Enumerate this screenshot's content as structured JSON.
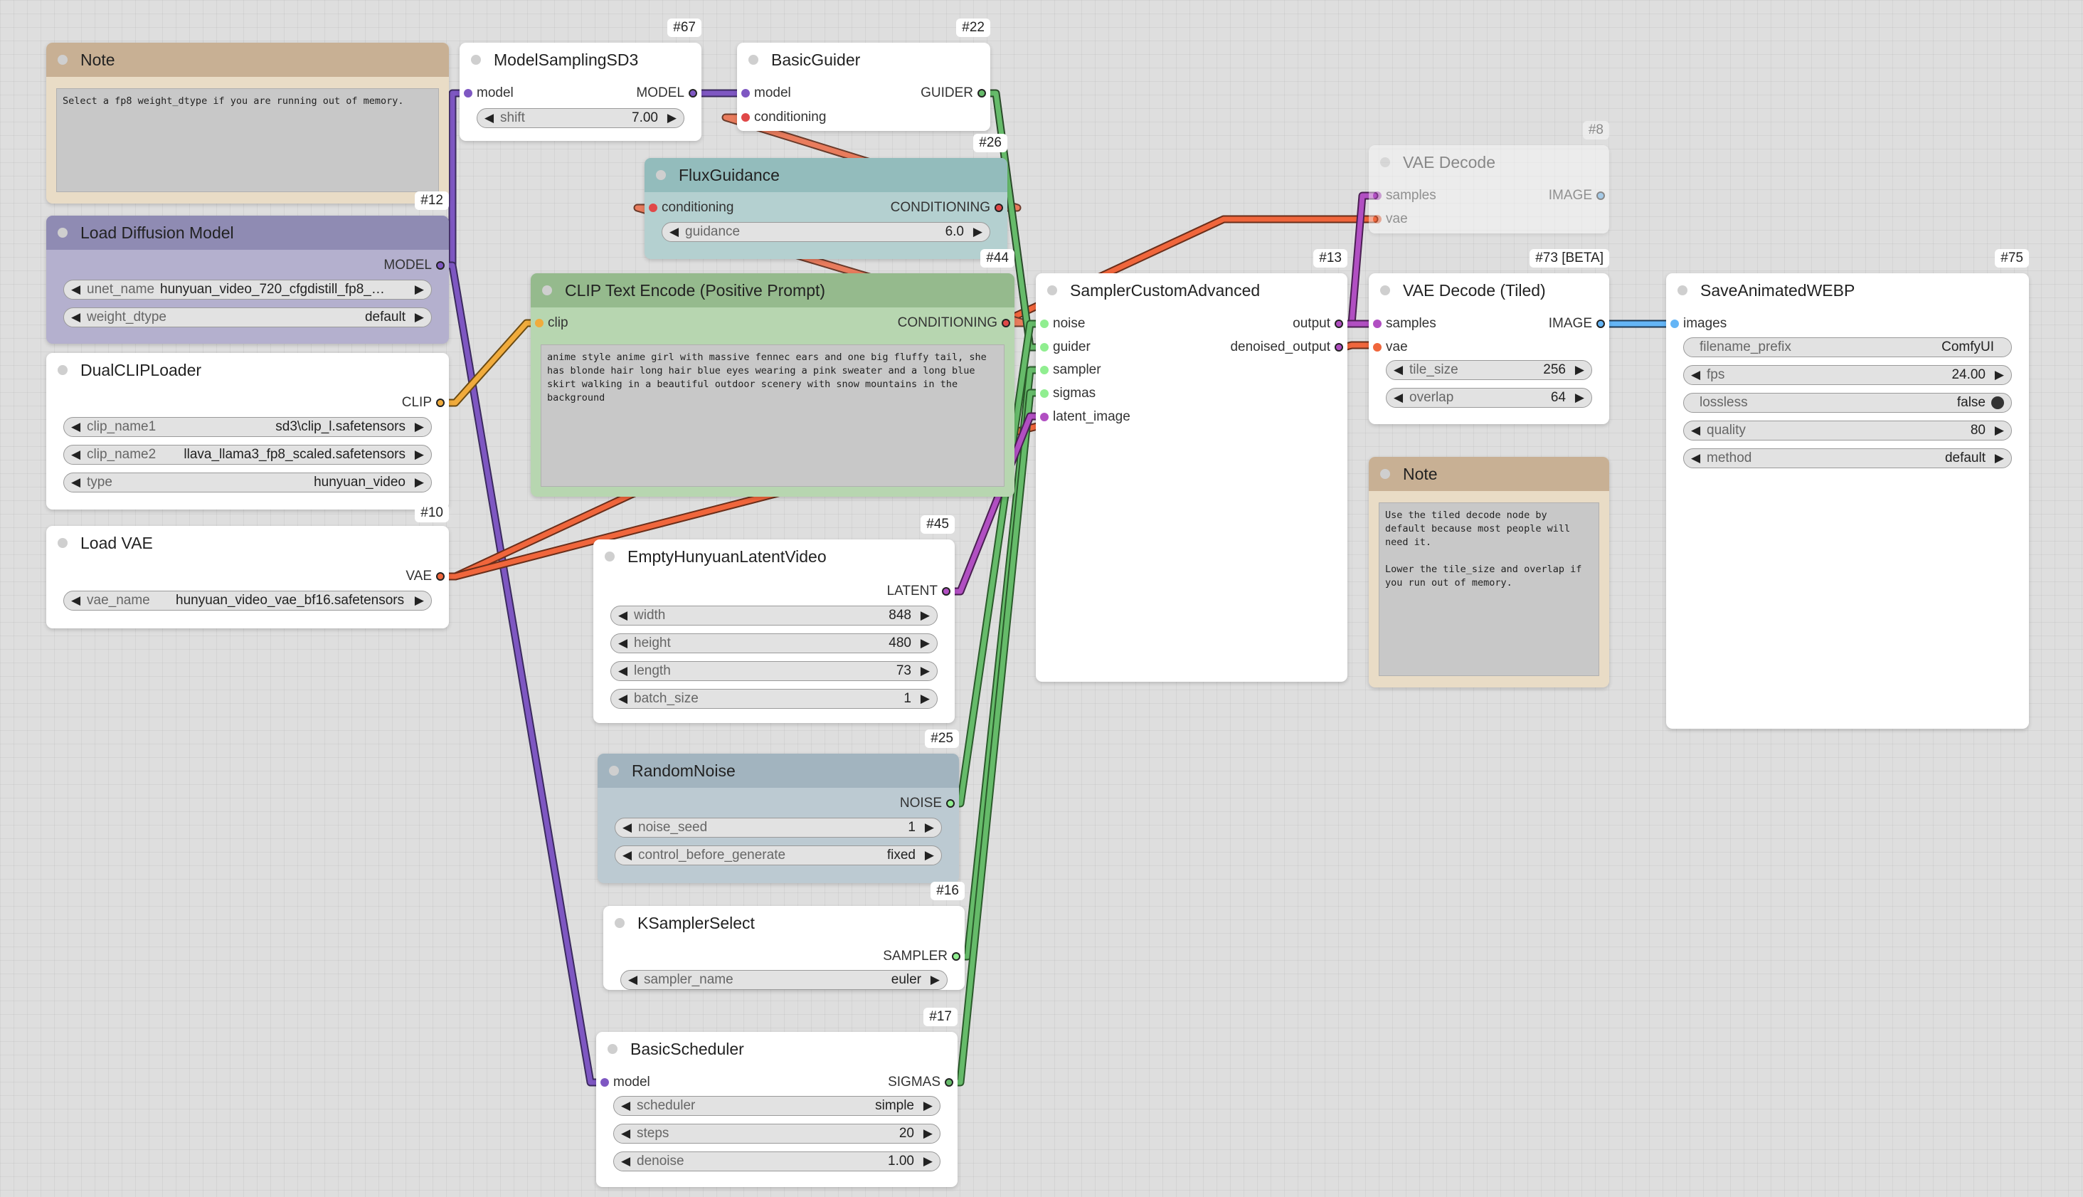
{
  "colors": {
    "model": "#7e57c2",
    "clip": "#f0ab3c",
    "vae": "#f0663c",
    "conditioning": "#e97c5d",
    "guider": "#66bb6a",
    "latent": "#b14fc2",
    "image": "#64b5f6",
    "noise": "#90ee90",
    "sigmas": "#66bb6a"
  },
  "nodes": {
    "note1": {
      "title": "Note",
      "text": "Select a fp8 weight_dtype if you are running out of memory."
    },
    "load_diffusion": {
      "id": "#12",
      "title": "Load Diffusion Model",
      "output": "MODEL",
      "widgets": [
        {
          "name": "unet_name",
          "value": "hunyuan_video_720_cfgdistill_fp8_…"
        },
        {
          "name": "weight_dtype",
          "value": "default"
        }
      ]
    },
    "dualclip": {
      "id": "#10",
      "title": "DualCLIPLoader",
      "output": "CLIP",
      "widgets": [
        {
          "name": "clip_name1",
          "value": "sd3\\clip_l.safetensors"
        },
        {
          "name": "clip_name2",
          "value": "llava_llama3_fp8_scaled.safetensors"
        },
        {
          "name": "type",
          "value": "hunyuan_video"
        }
      ]
    },
    "load_vae": {
      "title": "Load VAE",
      "output": "VAE",
      "widgets": [
        {
          "name": "vae_name",
          "value": "hunyuan_video_vae_bf16.safetensors"
        }
      ]
    },
    "modelsampling": {
      "id": "#67",
      "title": "ModelSamplingSD3",
      "input": "model",
      "output": "MODEL",
      "widgets": [
        {
          "name": "shift",
          "value": "7.00"
        }
      ]
    },
    "basicguider": {
      "id": "#22",
      "title": "BasicGuider",
      "inputs": [
        "model",
        "conditioning"
      ],
      "output": "GUIDER"
    },
    "fluxguidance": {
      "id": "#26",
      "title": "FluxGuidance",
      "input": "conditioning",
      "output": "CONDITIONING",
      "widgets": [
        {
          "name": "guidance",
          "value": "6.0"
        }
      ]
    },
    "clipencode": {
      "id": "#44",
      "title": "CLIP Text Encode (Positive Prompt)",
      "input": "clip",
      "output": "CONDITIONING",
      "text": "anime style anime girl with massive fennec ears and one big fluffy tail, she has blonde hair long hair blue eyes wearing a pink sweater and a long blue skirt walking in a beautiful outdoor scenery with snow mountains in the background"
    },
    "emptylatent": {
      "id": "#45",
      "title": "EmptyHunyuanLatentVideo",
      "output": "LATENT",
      "widgets": [
        {
          "name": "width",
          "value": "848"
        },
        {
          "name": "height",
          "value": "480"
        },
        {
          "name": "length",
          "value": "73"
        },
        {
          "name": "batch_size",
          "value": "1"
        }
      ]
    },
    "randomnoise": {
      "id": "#25",
      "title": "RandomNoise",
      "output": "NOISE",
      "widgets": [
        {
          "name": "noise_seed",
          "value": "1"
        },
        {
          "name": "control_before_generate",
          "value": "fixed"
        }
      ]
    },
    "ksamplerselect": {
      "id": "#16",
      "title": "KSamplerSelect",
      "output": "SAMPLER",
      "widgets": [
        {
          "name": "sampler_name",
          "value": "euler"
        }
      ]
    },
    "basicscheduler": {
      "id": "#17",
      "title": "BasicScheduler",
      "input": "model",
      "output": "SIGMAS",
      "widgets": [
        {
          "name": "scheduler",
          "value": "simple"
        },
        {
          "name": "steps",
          "value": "20"
        },
        {
          "name": "denoise",
          "value": "1.00"
        }
      ]
    },
    "sampler": {
      "id": "#13",
      "title": "SamplerCustomAdvanced",
      "inputs": [
        "noise",
        "guider",
        "sampler",
        "sigmas",
        "latent_image"
      ],
      "outputs": [
        "output",
        "denoised_output"
      ]
    },
    "vaedecode": {
      "id": "#8",
      "title": "VAE Decode",
      "inputs": [
        "samples",
        "vae"
      ],
      "output": "IMAGE"
    },
    "vaedecodetiled": {
      "id": "#73 [BETA]",
      "title": "VAE Decode (Tiled)",
      "inputs": [
        "samples",
        "vae"
      ],
      "output": "IMAGE",
      "widgets": [
        {
          "name": "tile_size",
          "value": "256"
        },
        {
          "name": "overlap",
          "value": "64"
        }
      ]
    },
    "note2": {
      "title": "Note",
      "text": "Use the tiled decode node by default because most people will need it.\n\nLower the tile_size and overlap if you run out of memory."
    },
    "saveanimated": {
      "id": "#75",
      "title": "SaveAnimatedWEBP",
      "input": "images",
      "widgets": [
        {
          "name": "filename_prefix",
          "value": "ComfyUI"
        },
        {
          "name": "fps",
          "value": "24.00"
        },
        {
          "name": "lossless",
          "value": "false"
        },
        {
          "name": "quality",
          "value": "80"
        },
        {
          "name": "method",
          "value": "default"
        }
      ]
    }
  }
}
